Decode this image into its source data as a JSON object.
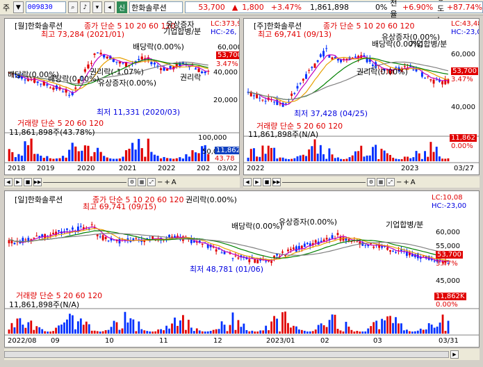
{
  "toolbar": {
    "mode_label": "주",
    "code": "009830",
    "badge": "신",
    "name": "한화솔루션",
    "price": "53,700",
    "change": "1,800",
    "change_pct": "+3.47%",
    "volume": "1,861,898",
    "ratio": "0%",
    "turnover_label": "회전율 :",
    "turnover": "+6.90%",
    "strength_label": "강도 :",
    "strength": "+87.74%"
  },
  "monthly": {
    "title": "[월]한화솔루션",
    "legend": "종가 단순 5 10 20 60 120",
    "lc": "LC:373,9",
    "hc": "HC:-26,",
    "high": "최고 73,284 (2021/01)",
    "low": "최저 11,331 (2020/03)",
    "ann_div1": "배당락(0.00%)",
    "ann_div2": "배당락(0.00%)",
    "ann_right": "권리락(-1.07%)",
    "ann_cap": "유상증자(0.00%)",
    "ann_merge": "기업합병/분",
    "ann_right2": "권리락",
    "ann_cap2": "유상증자",
    "ann_div3": "배당락(0.00%)",
    "y_ticks": [
      "60,000",
      "40,000",
      "20,000"
    ],
    "tag_price": "53,700",
    "tag_pct": "3.47%",
    "vol_title": "거래량 단순 5 20 60 120",
    "vol_val": "11,861,898주(43.78%)",
    "vol_ticks": [
      "100,000",
      "50,000"
    ],
    "vol_tag": "11,862",
    "vol_tag_pct": "43.78",
    "x_labels": [
      "2018",
      "2019",
      "2020",
      "2021",
      "2022",
      "202"
    ],
    "x_end": "03/02"
  },
  "weekly": {
    "title": "[주]한화솔루션",
    "legend": "종가 단순 5 10 20 60 120",
    "lc": "LC:43,48",
    "hc": "HC:-23,0",
    "high": "최고 69,741 (09/13)",
    "low": "최저 37,428 (04/25)",
    "ann_cap": "유상증자(0.00%)",
    "ann_div": "배당락(0.00%)",
    "ann_merge": "기업합병/분",
    "ann_right": "권리락(0.00%)",
    "y_ticks": [
      "60,000",
      "40,000"
    ],
    "tag_price": "53,700",
    "tag_pct": "3.47%",
    "vol_title": "거래량 단순 5 20 60 120",
    "vol_val": "11,861,898주(N/A)",
    "vol_tag": "11,862",
    "vol_tag_pct": "0.00%",
    "x_labels": [
      "2022",
      "2023"
    ],
    "x_end": "03/27"
  },
  "daily": {
    "title": "[일]한화솔루션",
    "legend": "종가 단순 5 10 20 60 120",
    "ann_top": "권리락(0.00%)",
    "lc": "LC:10,08",
    "hc": "HC:-23,00",
    "high": "최고 69,741 (09/15)",
    "low": "최저 48,781 (01/06)",
    "ann_div": "배당락(0.00%)",
    "ann_cap": "유상증자(0.00%)",
    "ann_merge": "기업합병/분",
    "y_ticks": [
      "60,000",
      "55,000",
      "45,000"
    ],
    "tag_price": "53,700",
    "tag_pct": "3.47%",
    "vol_title": "거래량 단순 5 20 60 120",
    "vol_val": "11,861,898주(N/A)",
    "vol_tag": "11,862K",
    "vol_tag_pct": "0.00%",
    "x_labels": [
      "2022/08",
      "09",
      "10",
      "11",
      "12",
      "2023/01",
      "02",
      "03"
    ],
    "x_end": "03/31"
  },
  "colors": {
    "up": "#e00000",
    "down": "#0030ff",
    "ma5": "#c000c0",
    "ma20": "#e8a000",
    "ma60": "#008000",
    "ma120": "#808080"
  }
}
